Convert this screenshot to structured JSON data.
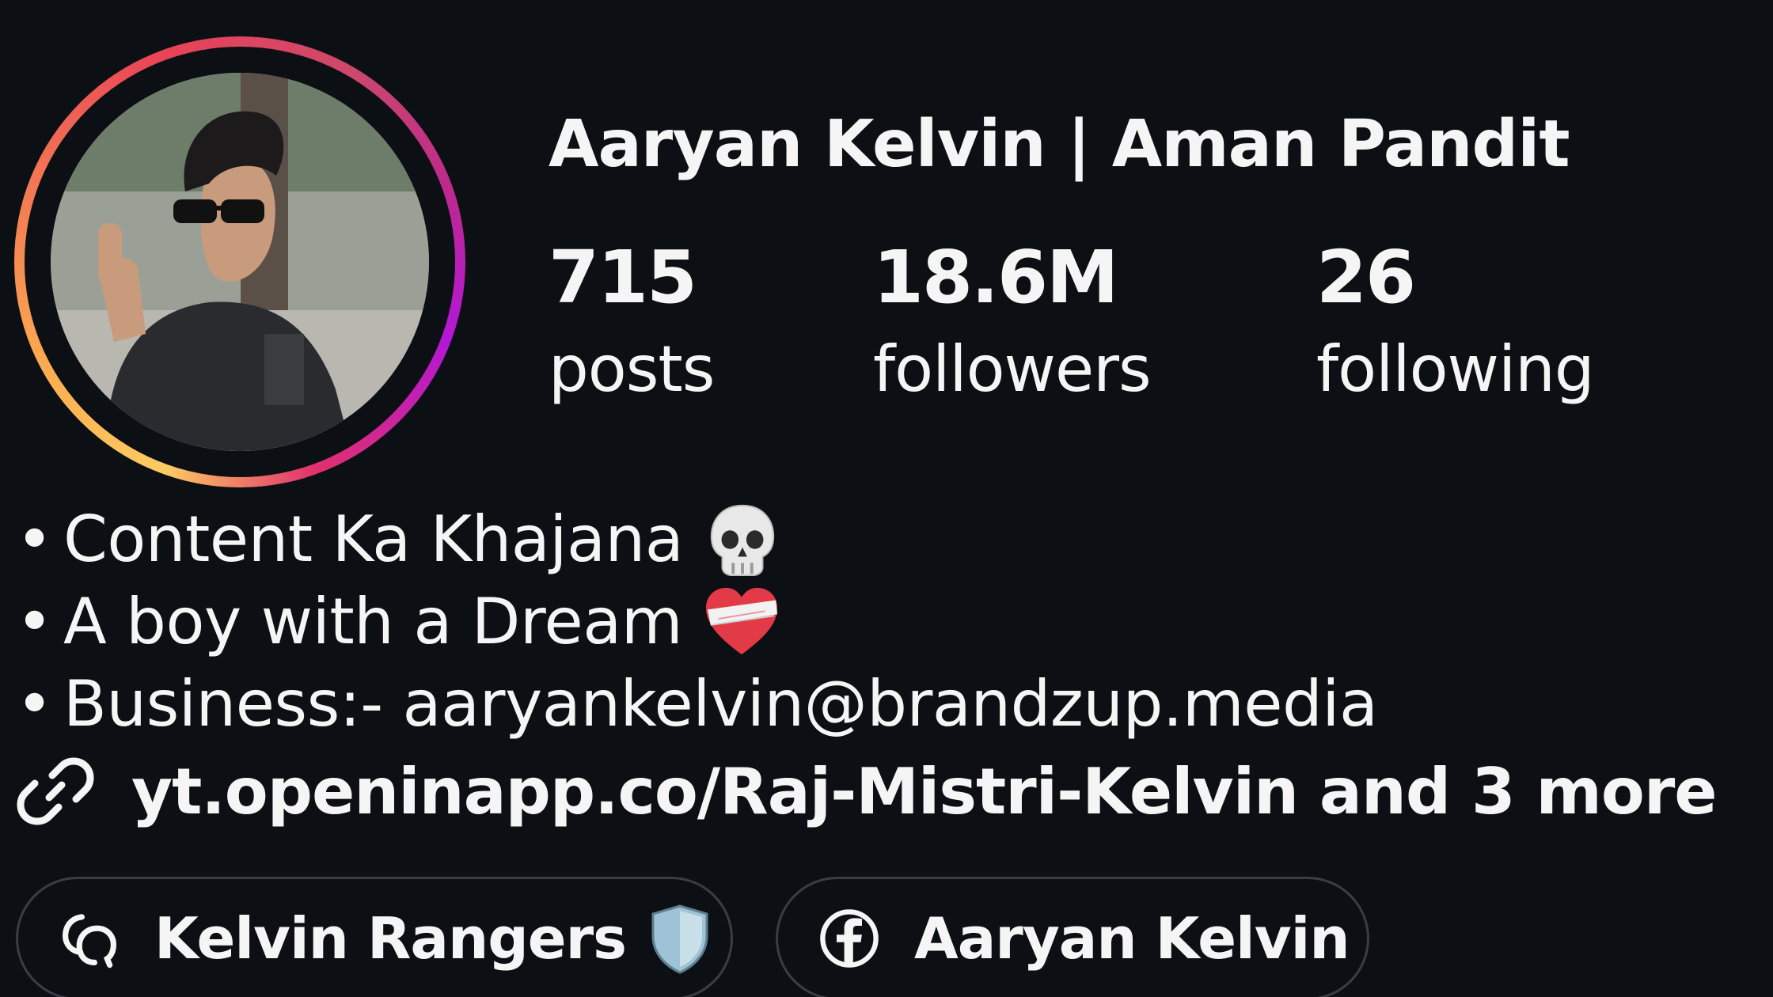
{
  "profile": {
    "name": "Aaryan Kelvin | Aman Pandit",
    "stats": {
      "posts_count": "715",
      "posts_label": "posts",
      "followers_count": "18.6M",
      "followers_label": "followers",
      "following_count": "26",
      "following_label": "following"
    },
    "bio": {
      "bullet": "•",
      "line1": "Content Ka Khajana",
      "line1_emoji": "skull-icon",
      "line2": "A boy with a Dream",
      "line2_emoji": "mending-heart-icon",
      "line3": "Business:- aaryankelvin@brandzup.media"
    },
    "link": {
      "text": "yt.openinapp.co/Raj-Mistri-Kelvin and 3 more",
      "icon": "link-icon"
    },
    "chips": [
      {
        "label": "Kelvin Rangers",
        "icon": "threads-icon",
        "trailing_icon": "shield-icon"
      },
      {
        "label": "Aaryan Kelvin",
        "icon": "facebook-icon"
      }
    ]
  },
  "colors": {
    "background": "#0c0f14",
    "text": "#f5f5f5",
    "chip_border": "#3a3d44",
    "story_ring_start": "#fccc63",
    "story_ring_end": "#bc2a8d"
  }
}
